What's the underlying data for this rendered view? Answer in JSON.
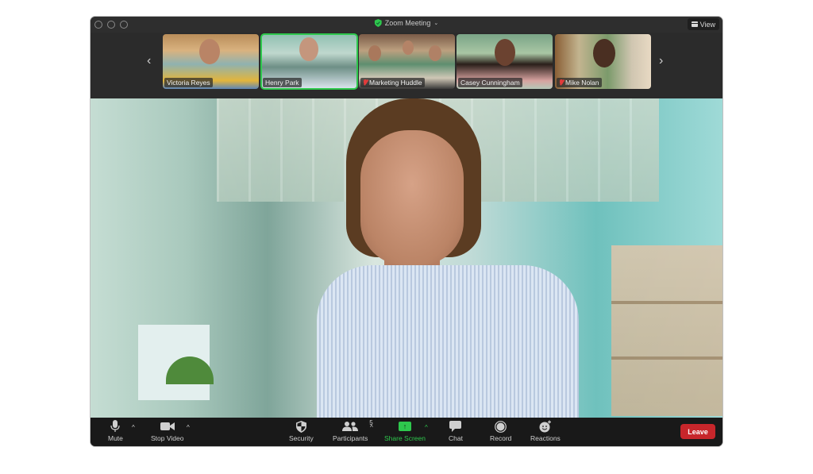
{
  "window": {
    "title": "Zoom Meeting",
    "view_label": "View",
    "accent_green": "#2ec84d",
    "leave_red": "#c7262b"
  },
  "gallery": {
    "prev_icon": "‹",
    "next_icon": "›",
    "participants": [
      {
        "name": "Victoria Reyes",
        "muted": false,
        "active": false
      },
      {
        "name": "Henry Park",
        "muted": false,
        "active": true
      },
      {
        "name": "Marketing Huddle",
        "muted": true,
        "active": false
      },
      {
        "name": "Casey Cunningham",
        "muted": false,
        "active": false
      },
      {
        "name": "Mike Nolan",
        "muted": true,
        "active": false
      }
    ]
  },
  "toolbar": {
    "mute_label": "Mute",
    "stop_video_label": "Stop Video",
    "security_label": "Security",
    "participants_label": "Participants",
    "participants_count": "5",
    "share_screen_label": "Share Screen",
    "chat_label": "Chat",
    "record_label": "Record",
    "reactions_label": "Reactions",
    "leave_label": "Leave",
    "caret": "^"
  }
}
